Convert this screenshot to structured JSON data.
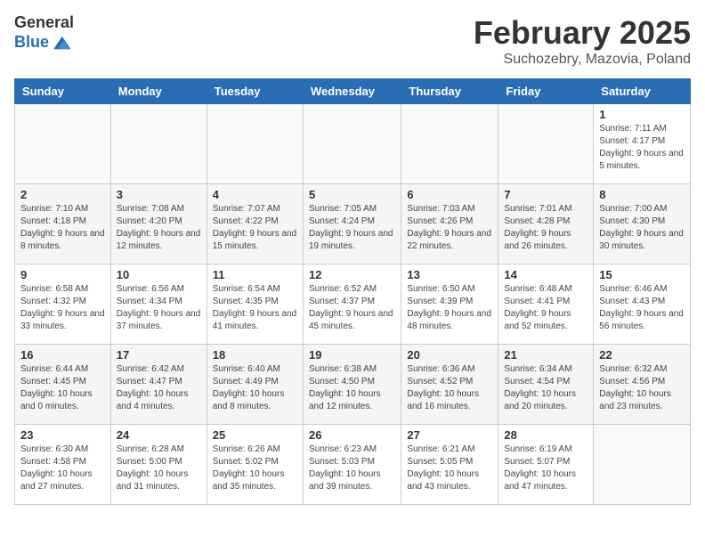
{
  "header": {
    "logo_general": "General",
    "logo_blue": "Blue",
    "month_title": "February 2025",
    "subtitle": "Suchozebry, Mazovia, Poland"
  },
  "weekdays": [
    "Sunday",
    "Monday",
    "Tuesday",
    "Wednesday",
    "Thursday",
    "Friday",
    "Saturday"
  ],
  "weeks": [
    [
      {
        "day": "",
        "info": ""
      },
      {
        "day": "",
        "info": ""
      },
      {
        "day": "",
        "info": ""
      },
      {
        "day": "",
        "info": ""
      },
      {
        "day": "",
        "info": ""
      },
      {
        "day": "",
        "info": ""
      },
      {
        "day": "1",
        "info": "Sunrise: 7:11 AM\nSunset: 4:17 PM\nDaylight: 9 hours and 5 minutes."
      }
    ],
    [
      {
        "day": "2",
        "info": "Sunrise: 7:10 AM\nSunset: 4:18 PM\nDaylight: 9 hours and 8 minutes."
      },
      {
        "day": "3",
        "info": "Sunrise: 7:08 AM\nSunset: 4:20 PM\nDaylight: 9 hours and 12 minutes."
      },
      {
        "day": "4",
        "info": "Sunrise: 7:07 AM\nSunset: 4:22 PM\nDaylight: 9 hours and 15 minutes."
      },
      {
        "day": "5",
        "info": "Sunrise: 7:05 AM\nSunset: 4:24 PM\nDaylight: 9 hours and 19 minutes."
      },
      {
        "day": "6",
        "info": "Sunrise: 7:03 AM\nSunset: 4:26 PM\nDaylight: 9 hours and 22 minutes."
      },
      {
        "day": "7",
        "info": "Sunrise: 7:01 AM\nSunset: 4:28 PM\nDaylight: 9 hours and 26 minutes."
      },
      {
        "day": "8",
        "info": "Sunrise: 7:00 AM\nSunset: 4:30 PM\nDaylight: 9 hours and 30 minutes."
      }
    ],
    [
      {
        "day": "9",
        "info": "Sunrise: 6:58 AM\nSunset: 4:32 PM\nDaylight: 9 hours and 33 minutes."
      },
      {
        "day": "10",
        "info": "Sunrise: 6:56 AM\nSunset: 4:34 PM\nDaylight: 9 hours and 37 minutes."
      },
      {
        "day": "11",
        "info": "Sunrise: 6:54 AM\nSunset: 4:35 PM\nDaylight: 9 hours and 41 minutes."
      },
      {
        "day": "12",
        "info": "Sunrise: 6:52 AM\nSunset: 4:37 PM\nDaylight: 9 hours and 45 minutes."
      },
      {
        "day": "13",
        "info": "Sunrise: 6:50 AM\nSunset: 4:39 PM\nDaylight: 9 hours and 48 minutes."
      },
      {
        "day": "14",
        "info": "Sunrise: 6:48 AM\nSunset: 4:41 PM\nDaylight: 9 hours and 52 minutes."
      },
      {
        "day": "15",
        "info": "Sunrise: 6:46 AM\nSunset: 4:43 PM\nDaylight: 9 hours and 56 minutes."
      }
    ],
    [
      {
        "day": "16",
        "info": "Sunrise: 6:44 AM\nSunset: 4:45 PM\nDaylight: 10 hours and 0 minutes."
      },
      {
        "day": "17",
        "info": "Sunrise: 6:42 AM\nSunset: 4:47 PM\nDaylight: 10 hours and 4 minutes."
      },
      {
        "day": "18",
        "info": "Sunrise: 6:40 AM\nSunset: 4:49 PM\nDaylight: 10 hours and 8 minutes."
      },
      {
        "day": "19",
        "info": "Sunrise: 6:38 AM\nSunset: 4:50 PM\nDaylight: 10 hours and 12 minutes."
      },
      {
        "day": "20",
        "info": "Sunrise: 6:36 AM\nSunset: 4:52 PM\nDaylight: 10 hours and 16 minutes."
      },
      {
        "day": "21",
        "info": "Sunrise: 6:34 AM\nSunset: 4:54 PM\nDaylight: 10 hours and 20 minutes."
      },
      {
        "day": "22",
        "info": "Sunrise: 6:32 AM\nSunset: 4:56 PM\nDaylight: 10 hours and 23 minutes."
      }
    ],
    [
      {
        "day": "23",
        "info": "Sunrise: 6:30 AM\nSunset: 4:58 PM\nDaylight: 10 hours and 27 minutes."
      },
      {
        "day": "24",
        "info": "Sunrise: 6:28 AM\nSunset: 5:00 PM\nDaylight: 10 hours and 31 minutes."
      },
      {
        "day": "25",
        "info": "Sunrise: 6:26 AM\nSunset: 5:02 PM\nDaylight: 10 hours and 35 minutes."
      },
      {
        "day": "26",
        "info": "Sunrise: 6:23 AM\nSunset: 5:03 PM\nDaylight: 10 hours and 39 minutes."
      },
      {
        "day": "27",
        "info": "Sunrise: 6:21 AM\nSunset: 5:05 PM\nDaylight: 10 hours and 43 minutes."
      },
      {
        "day": "28",
        "info": "Sunrise: 6:19 AM\nSunset: 5:07 PM\nDaylight: 10 hours and 47 minutes."
      },
      {
        "day": "",
        "info": ""
      }
    ]
  ]
}
